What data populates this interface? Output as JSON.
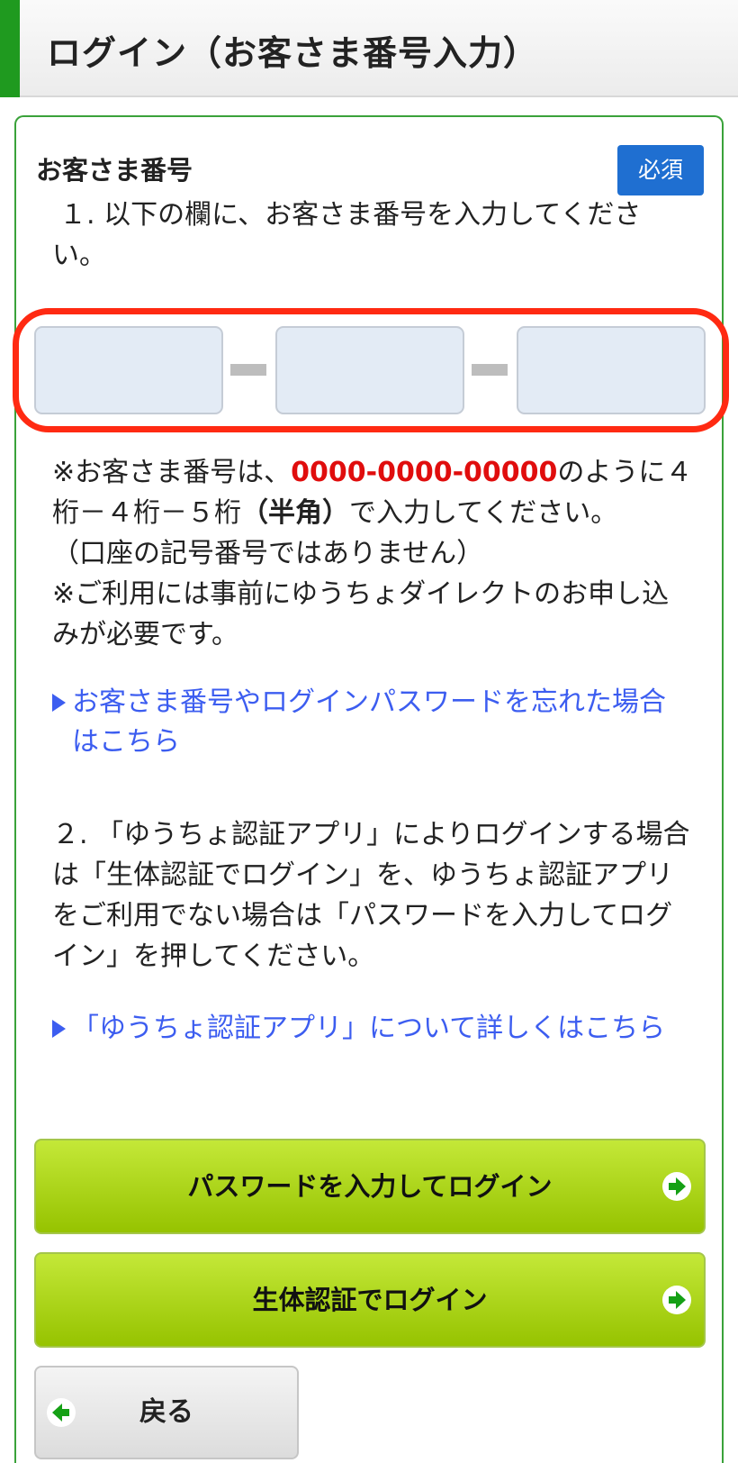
{
  "header": {
    "title": "ログイン（お客さま番号入力）"
  },
  "form": {
    "section_label": "お客さま番号",
    "required_badge": "必須",
    "instruction1": "１. 以下の欄に、お客さま番号を入力してください。",
    "inputs": [
      {
        "value": "",
        "placeholder": ""
      },
      {
        "value": "",
        "placeholder": ""
      },
      {
        "value": "",
        "placeholder": ""
      }
    ],
    "note_prefix": "※お客さま番号は、",
    "note_example": "0000-0000-00000",
    "note_mid": "のように４桁－４桁－５桁",
    "note_bold": "（半角）",
    "note_suffix": "で入力してください。",
    "note_paren": "（口座の記号番号ではありません）",
    "note2": "※ご利用には事前にゆうちょダイレクトのお申し込みが必要です。",
    "forgot_link": "お客さま番号やログインパスワードを忘れた場合はこちら",
    "instruction2": "２. 「ゆうちょ認証アプリ」によりログインする場合は「生体認証でログイン」を、ゆうちょ認証アプリをご利用でない場合は「パスワードを入力してログイン」を押してください。",
    "app_link": "「ゆうちょ認証アプリ」について詳しくはこちら"
  },
  "buttons": {
    "password_login": "パスワードを入力してログイン",
    "biometric_login": "生体認証でログイン",
    "back": "戻る"
  },
  "colors": {
    "accent_green": "#1f9a1f",
    "required_blue": "#1f6fd1",
    "link_blue": "#3c5df0",
    "highlight_red": "#ff2a12",
    "example_red": "#e00d0d"
  }
}
